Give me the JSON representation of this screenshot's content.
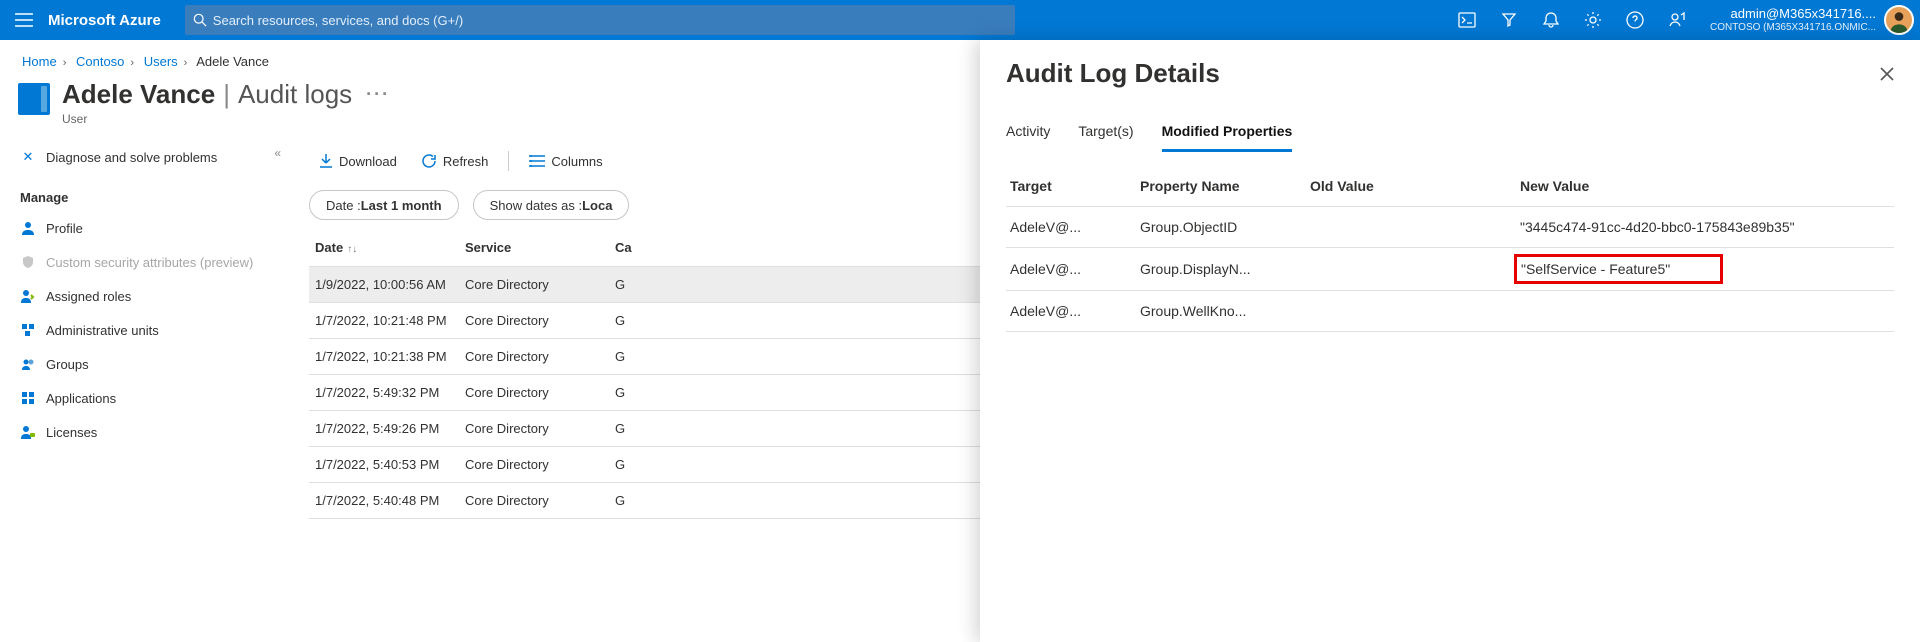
{
  "topbar": {
    "brand": "Microsoft Azure",
    "search_placeholder": "Search resources, services, and docs (G+/)",
    "account_line1": "admin@M365x341716....",
    "account_line2": "CONTOSO (M365X341716.ONMIC..."
  },
  "breadcrumb": {
    "items": [
      "Home",
      "Contoso",
      "Users",
      "Adele Vance"
    ]
  },
  "title": {
    "name": "Adele Vance",
    "section": "Audit logs",
    "subtitle": "User"
  },
  "sidebar": {
    "diag": "Diagnose and solve problems",
    "manage_header": "Manage",
    "items": [
      {
        "label": "Profile",
        "icon": "person-icon",
        "color": "#0078d4"
      },
      {
        "label": "Custom security attributes (preview)",
        "icon": "shield-icon",
        "disabled": true
      },
      {
        "label": "Assigned roles",
        "icon": "role-icon",
        "color": "#0078d4"
      },
      {
        "label": "Administrative units",
        "icon": "units-icon",
        "color": "#0078d4"
      },
      {
        "label": "Groups",
        "icon": "group-icon",
        "color": "#0078d4"
      },
      {
        "label": "Applications",
        "icon": "apps-icon",
        "color": "#0078d4"
      },
      {
        "label": "Licenses",
        "icon": "license-icon",
        "color": "#0078d4"
      }
    ]
  },
  "toolbar": {
    "download": "Download",
    "refresh": "Refresh",
    "columns": "Columns"
  },
  "filters": {
    "date_label": "Date : ",
    "date_value": "Last 1 month",
    "show_label": "Show dates as : ",
    "show_value": "Loca"
  },
  "log_table": {
    "headers": {
      "date": "Date",
      "service": "Service",
      "category": "Ca"
    },
    "rows": [
      {
        "date": "1/9/2022, 10:00:56 AM",
        "service": "Core Directory",
        "cat": "G",
        "selected": true
      },
      {
        "date": "1/7/2022, 10:21:48 PM",
        "service": "Core Directory",
        "cat": "G"
      },
      {
        "date": "1/7/2022, 10:21:38 PM",
        "service": "Core Directory",
        "cat": "G"
      },
      {
        "date": "1/7/2022, 5:49:32 PM",
        "service": "Core Directory",
        "cat": "G"
      },
      {
        "date": "1/7/2022, 5:49:26 PM",
        "service": "Core Directory",
        "cat": "G"
      },
      {
        "date": "1/7/2022, 5:40:53 PM",
        "service": "Core Directory",
        "cat": "G"
      },
      {
        "date": "1/7/2022, 5:40:48 PM",
        "service": "Core Directory",
        "cat": "G"
      }
    ]
  },
  "panel": {
    "title": "Audit Log Details",
    "tabs": {
      "activity": "Activity",
      "targets": "Target(s)",
      "modified": "Modified Properties"
    },
    "headers": {
      "target": "Target",
      "prop": "Property Name",
      "old": "Old Value",
      "new": "New Value"
    },
    "rows": [
      {
        "target": "AdeleV@...",
        "prop": "Group.ObjectID",
        "old": "",
        "new": "\"3445c474-91cc-4d20-bbc0-175843e89b35\""
      },
      {
        "target": "AdeleV@...",
        "prop": "Group.DisplayN...",
        "old": "",
        "new": "\"SelfService - Feature5\"",
        "highlight": true
      },
      {
        "target": "AdeleV@...",
        "prop": "Group.WellKno...",
        "old": "",
        "new": ""
      }
    ]
  }
}
